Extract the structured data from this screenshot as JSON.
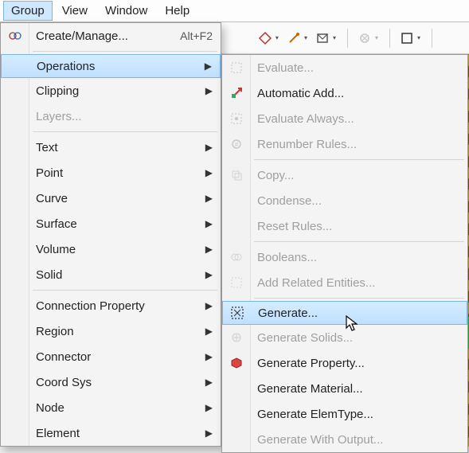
{
  "menubar": {
    "group": "Group",
    "view": "View",
    "window": "Window",
    "help": "Help"
  },
  "group_menu": {
    "create_manage": {
      "label": "Create/Manage...",
      "accel": "Alt+F2"
    },
    "operations": "Operations",
    "clipping": "Clipping",
    "layers": "Layers...",
    "text": "Text",
    "point": "Point",
    "curve": "Curve",
    "surface": "Surface",
    "volume": "Volume",
    "solid": "Solid",
    "connection_property": "Connection Property",
    "region": "Region",
    "connector": "Connector",
    "coord_sys": "Coord Sys",
    "node": "Node",
    "element": "Element"
  },
  "operations_submenu": {
    "evaluate": "Evaluate...",
    "automatic_add": "Automatic Add...",
    "evaluate_always": "Evaluate Always...",
    "renumber_rules": "Renumber Rules...",
    "copy": "Copy...",
    "condense": "Condense...",
    "reset_rules": "Reset Rules...",
    "booleans": "Booleans...",
    "add_related": "Add Related Entities...",
    "generate": "Generate...",
    "generate_solids": "Generate Solids...",
    "generate_property": "Generate Property...",
    "generate_material": "Generate Material...",
    "generate_elemtype": "Generate ElemType...",
    "generate_with_output": "Generate With Output..."
  }
}
